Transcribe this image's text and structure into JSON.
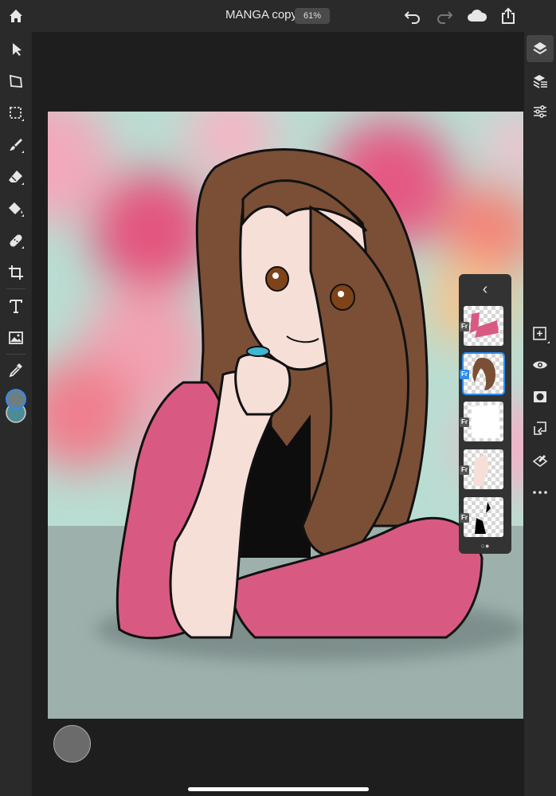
{
  "document": {
    "title": "MANGA copy",
    "zoom": "61%"
  },
  "left_tools": [
    "select-arrow-icon",
    "transform-icon",
    "marquee-selection-icon",
    "brush-icon",
    "eraser-icon",
    "paint-bucket-icon",
    "healing-icon",
    "crop-icon",
    "type-icon",
    "image-icon",
    "eyedropper-icon"
  ],
  "right_tools": {
    "top": [
      "layers-icon",
      "layer-properties-icon",
      "adjustments-icon"
    ],
    "bottom": [
      "add-layer-icon",
      "visibility-eye-icon",
      "mask-icon",
      "clipping-icon",
      "fill-layer-icon",
      "more-icon"
    ]
  },
  "colors": {
    "foreground": "#6e7f83",
    "background": "#4d8c95",
    "accent": "#2d8cf0"
  },
  "layers_panel": {
    "collapse_label": "‹",
    "badge": "Fr",
    "layers": [
      {
        "thumb": "pink-shawl"
      },
      {
        "thumb": "brown-hair",
        "selected": true
      },
      {
        "thumb": "white-fill"
      },
      {
        "thumb": "skin-tone"
      },
      {
        "thumb": "black-lineart"
      }
    ],
    "pager": [
      "○",
      "●"
    ]
  }
}
